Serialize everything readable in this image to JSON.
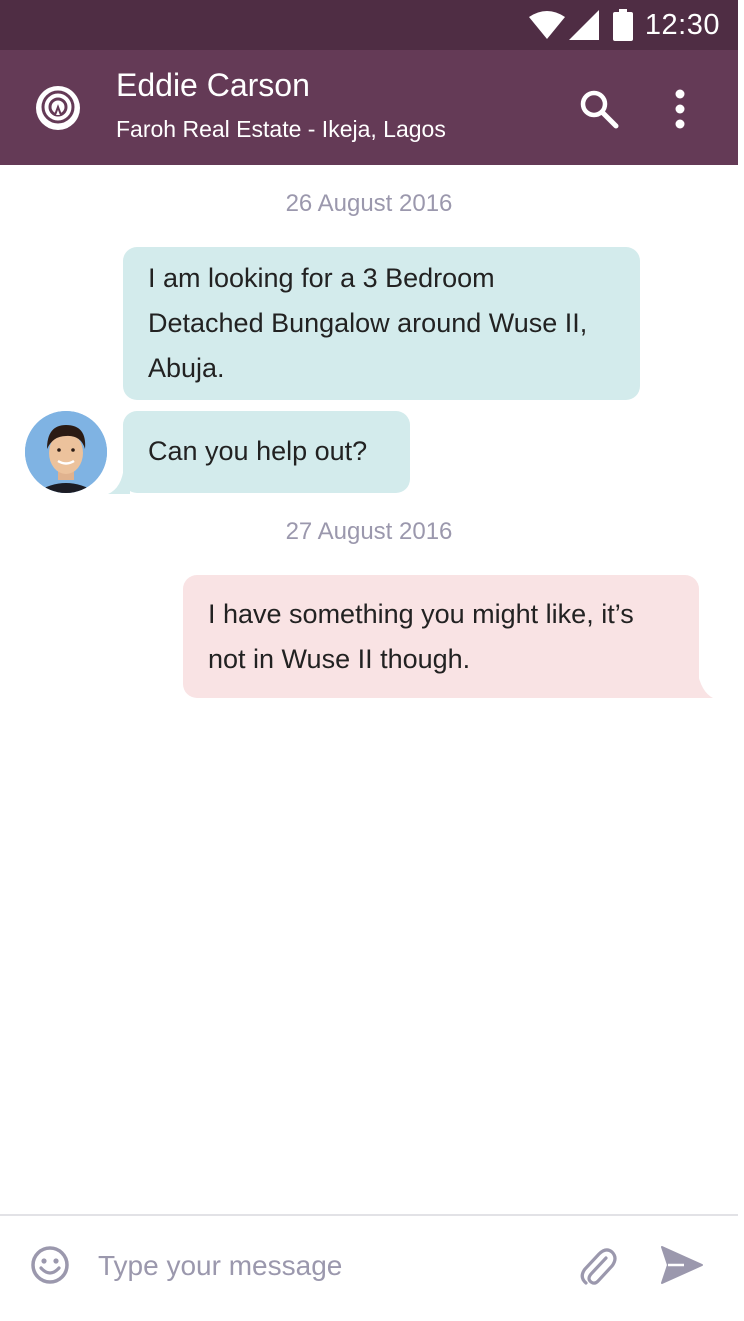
{
  "status_bar": {
    "time": "12:30",
    "icons": [
      "wifi-icon",
      "signal-icon",
      "battery-icon"
    ],
    "background": "#4f2d44"
  },
  "header": {
    "title": "Eddie Carson",
    "subtitle": "Faroh Real Estate - Ikeja, Lagos",
    "background": "#643a56",
    "actions": [
      "search-icon",
      "more-vert-icon"
    ]
  },
  "conversation": {
    "date_1": "26 August 2016",
    "messages_1": [
      "I am looking for a 3 Bedroom Detached Bungalow around Wuse II, Abuja.",
      "Can you help out?"
    ],
    "date_2": "27 August 2016",
    "messages_2": [
      "I have something you might like, it’s not in Wuse II though."
    ],
    "incoming_color": "#d3ebec",
    "outgoing_color": "#f9e3e4"
  },
  "composer": {
    "placeholder": "Type your message",
    "icons": [
      "emoji-icon",
      "attach-icon",
      "send-icon"
    ]
  }
}
